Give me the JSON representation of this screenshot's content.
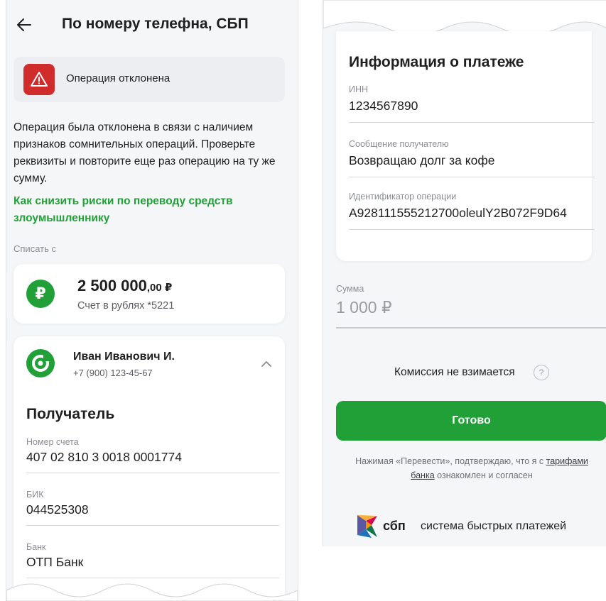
{
  "left": {
    "header": {
      "title": "По номеру телефна, СБП"
    },
    "alert": {
      "text": "Операция отклонена"
    },
    "description": "Операция была отклонена в связи с наличием признаков сомнительных операций. Проверьте реквизиты и повторите еще раз операцию на ту же сумму.",
    "risk_link": "Как снизить риски по переводу средств злоумышленнику",
    "from_label": "Списать с",
    "account": {
      "currency_symbol": "₽",
      "amount": "2 500 000",
      "cents": ",00 ₽",
      "name": "Счет в рублях *5221"
    },
    "recipient": {
      "name": "Иван Иванович И.",
      "phone": "+7 (900) 123-45-67",
      "section_title": "Получатель",
      "fields": [
        {
          "label": "Номер счета",
          "value": "407 02 810 3 0018 0001774"
        },
        {
          "label": "БИК",
          "value": "044525308"
        },
        {
          "label": "Банк",
          "value": "ОТП Банк"
        }
      ]
    }
  },
  "right": {
    "info_title": "Информация о платеже",
    "fields": [
      {
        "label": "ИНН",
        "value": "1234567890"
      },
      {
        "label": "Сообщение получателю",
        "value": "Возвращаю долг за кофе"
      },
      {
        "label": "Идентификатор операции",
        "value": "A928111555212700oleulY2B072F9D64"
      }
    ],
    "sum": {
      "label": "Сумма",
      "value": "1 000 ₽"
    },
    "fee_text": "Комиссия не взимается",
    "help_symbol": "?",
    "done_button": "Готово",
    "legal": {
      "prefix": "Нажимая «Перевести», подтверждаю, что я с",
      "link": "тарифами банка",
      "suffix": "ознакомлен и согласен"
    },
    "sbp": {
      "brand": "сбп",
      "text": "система быстрых платежей"
    }
  },
  "colors": {
    "accent": "#21a038",
    "danger": "#d12c2c",
    "panel_bg": "#f5f6f8"
  },
  "icons": [
    "back-arrow-icon",
    "warning-icon",
    "ruble-icon",
    "otp-bank-logo-icon",
    "chevron-up-icon",
    "help-icon",
    "sbp-logo-icon"
  ]
}
